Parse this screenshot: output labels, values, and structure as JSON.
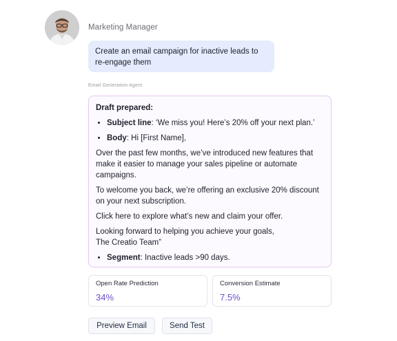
{
  "user": {
    "name": "Marketing Manager",
    "message": "Create an email campaign for inactive leads to re-engage them"
  },
  "agent": {
    "label": "Email Generation Agent",
    "draft_heading": "Draft prepared:",
    "subject_key": "Subject line",
    "subject_value": ": ‘We miss you! Here’s 20% off your next plan.’",
    "body_key": "Body",
    "body_value": ": Hi [First Name],",
    "paragraphs": [
      "Over the past few months, we’ve introduced new features that make it easier to manage your sales pipeline or automate campaigns.",
      "To welcome you back, we’re offering an exclusive 20% discount on your next subscription.",
      "Click here to explore what’s new and claim your offer."
    ],
    "closing_line1": "Looking forward to helping you achieve your goals,",
    "closing_line2": "The Creatio Team”",
    "segment_key": "Segment",
    "segment_value": ": Inactive leads >90 days."
  },
  "metrics": [
    {
      "label": "Open Rate Prediction",
      "value": "34%"
    },
    {
      "label": "Conversion Estimate",
      "value": "7.5%"
    }
  ],
  "actions": {
    "preview_label": "Preview Email",
    "send_label": "Send Test"
  },
  "colors": {
    "user_bubble": "#e4ecfd",
    "card_border": "#e6c6ef",
    "metric_value": "#6b4fc9"
  }
}
